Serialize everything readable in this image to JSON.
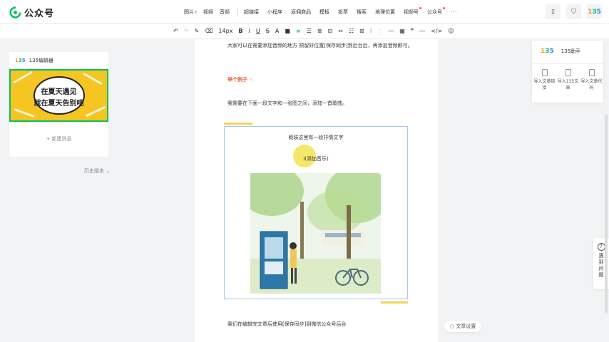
{
  "app": {
    "title": "公众号"
  },
  "media_tabs": [
    {
      "label": "图片"
    },
    {
      "label": "视频"
    },
    {
      "label": "音频"
    }
  ],
  "insert_tabs": [
    {
      "label": "超链接"
    },
    {
      "label": "小程序"
    },
    {
      "label": "返佣商品"
    },
    {
      "label": "模板"
    },
    {
      "label": "投票"
    },
    {
      "label": "搜索"
    },
    {
      "label": "地理位置"
    },
    {
      "label": "视频号"
    },
    {
      "label": "公众号"
    }
  ],
  "toolbar": {
    "font_size": "14px",
    "bold": "B",
    "italic": "I",
    "underline": "U",
    "strike": "S"
  },
  "sidebar": {
    "account_name": "135编辑器",
    "cover_line1": "在夏天遇见",
    "cover_line2": "就在夏天告别吧",
    "new_message": "+ 新建消息",
    "history_label": "历史版本"
  },
  "article": {
    "para1": "大家可以在需要添加音频的地方 预留好位置[保存同步]到后台后，再添加音频即可。",
    "example_title": "举个例子",
    "para2": "我需要在下面一段文字和一张图之间，添加一首歌曲。",
    "frame_text": "假装这里有一段抒情文字",
    "add_music": "(添加音乐)",
    "footer_text": "我们在编辑完文章后使用[保存同步]到微信公众号后台"
  },
  "helper": {
    "title": "135助手",
    "buttons": [
      {
        "label": "导入文章链接"
      },
      {
        "label": "导入135文章"
      },
      {
        "label": "导入文章代码"
      }
    ]
  },
  "help_float": {
    "label": "遇到问题"
  },
  "article_settings": "文章设置",
  "colors": {
    "brand_green": "#07c160",
    "accent_orange": "#e85a2a",
    "frame_border": "#a9c8ec",
    "cover_yellow": "#f5c521"
  }
}
